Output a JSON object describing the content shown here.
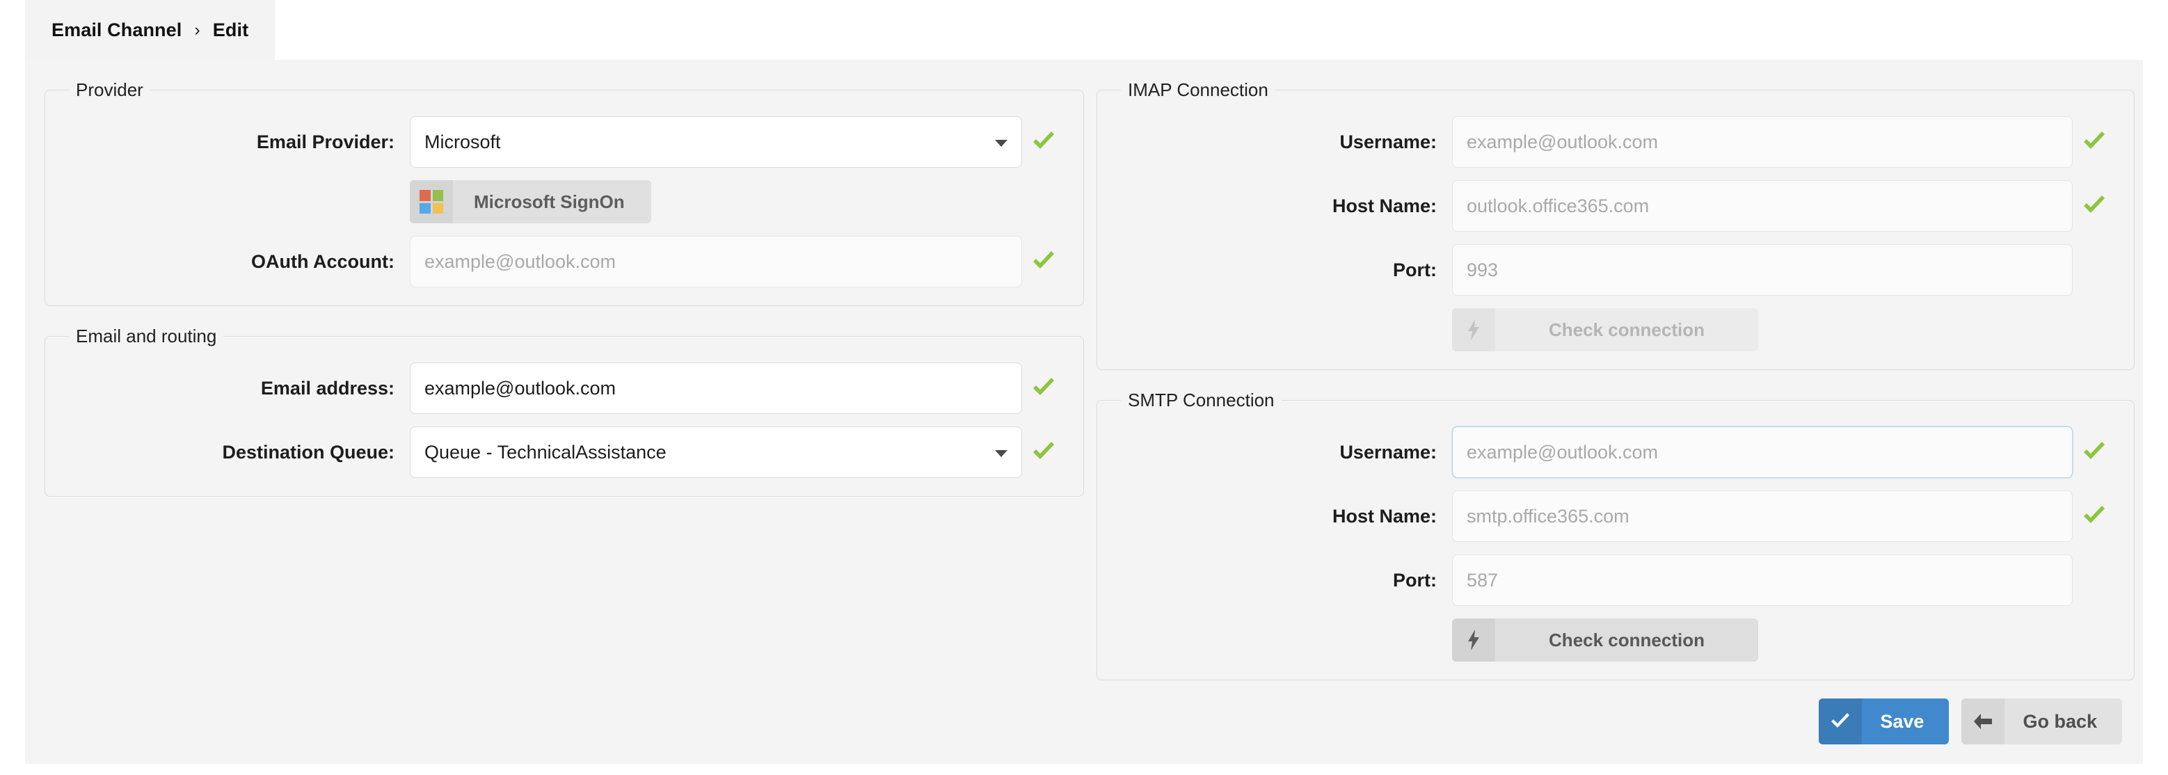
{
  "tab": {
    "crumb_parent": "Email Channel",
    "crumb_separator": "›",
    "crumb_current": "Edit"
  },
  "provider": {
    "legend": "Provider",
    "email_provider_label": "Email Provider:",
    "email_provider_value": "Microsoft",
    "email_provider_valid_icon": "green-check-icon",
    "signon_button_label": "Microsoft SignOn",
    "signon_logo_icon": "microsoft-logo-icon",
    "oauth_label": "OAuth Account:",
    "oauth_placeholder": "example@outlook.com",
    "oauth_value": "",
    "oauth_valid_icon": "green-check-icon"
  },
  "routing": {
    "legend": "Email and routing",
    "email_address_label": "Email address:",
    "email_address_value": "example@outlook.com",
    "email_address_valid_icon": "green-check-icon",
    "destination_queue_label": "Destination Queue:",
    "destination_queue_value": "Queue - TechnicalAssistance",
    "destination_queue_valid_icon": "green-check-icon"
  },
  "imap": {
    "legend": "IMAP Connection",
    "username_label": "Username:",
    "username_placeholder": "example@outlook.com",
    "username_value": "",
    "username_valid_icon": "green-check-icon",
    "hostname_label": "Host Name:",
    "hostname_placeholder": "outlook.office365.com",
    "hostname_value": "",
    "hostname_valid_icon": "green-check-icon",
    "port_label": "Port:",
    "port_placeholder": "993",
    "port_value": "",
    "check_button_label": "Check connection",
    "check_button_icon": "lightning-bolt-icon",
    "check_button_enabled": false
  },
  "smtp": {
    "legend": "SMTP Connection",
    "username_label": "Username:",
    "username_placeholder": "example@outlook.com",
    "username_value": "",
    "username_valid_icon": "green-check-icon",
    "hostname_label": "Host Name:",
    "hostname_placeholder": "smtp.office365.com",
    "hostname_value": "",
    "hostname_valid_icon": "green-check-icon",
    "port_label": "Port:",
    "port_placeholder": "587",
    "port_value": "",
    "check_button_label": "Check connection",
    "check_button_icon": "lightning-bolt-icon",
    "check_button_enabled": true
  },
  "footer": {
    "save_label": "Save",
    "save_icon": "check-icon",
    "go_back_label": "Go back",
    "go_back_icon": "arrow-left-icon"
  },
  "colors": {
    "accent_blue": "#4189cd",
    "accent_blue_dark": "#3a7cb8",
    "valid_green": "#8cc63f",
    "panel_bg": "#f4f4f4",
    "tab_bg": "#f3f3f3",
    "ms_red": "#df6a4d",
    "ms_green": "#96bf4f",
    "ms_blue": "#56a8e8",
    "ms_yellow": "#f0c254"
  }
}
